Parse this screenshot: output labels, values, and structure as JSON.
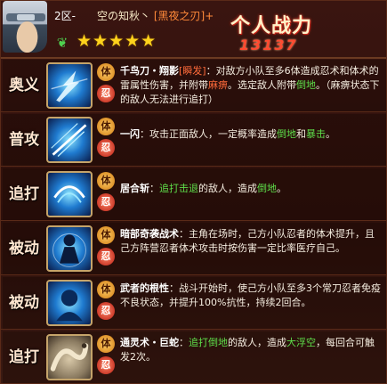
{
  "header": {
    "server": "2区-",
    "player_name": "空の知秋丶",
    "title": "[黑夜之刃]+",
    "stars": "★★★★★",
    "clan_icon": "leaf-clan-icon",
    "power_label": "个人战力",
    "power_value": "13137"
  },
  "skills": [
    {
      "category": "奥义",
      "icon": "chidori-lightning-icon",
      "name": "千鸟刀・翔影",
      "tag": "[瞬发]",
      "text_1": "：对敌方小队至多6体造成忍术和体术的雷属性伤害，并附带",
      "hl_1": "麻痹",
      "text_2": "。选定敌人附带",
      "hl_2": "倒地",
      "text_3": "。（麻痹状态下的敌人无法进行追打）"
    },
    {
      "category": "普攻",
      "icon": "slash-icon",
      "name": "一闪",
      "text_1": "：攻击正面敌人，一定概率造成",
      "hl_1": "倒地",
      "text_2": "和",
      "hl_2": "暴击",
      "text_3": "。"
    },
    {
      "category": "追打",
      "icon": "iai-slash-icon",
      "name": "居合斩",
      "text_1": "：",
      "hl_1": "追打击退",
      "text_2": "的敌人，造成",
      "hl_2": "倒地",
      "text_3": "。"
    },
    {
      "category": "被动",
      "icon": "shadow-figure-icon",
      "name": "暗部奇袭战术",
      "text_1": "：主角在场时，己方小队忍者的体术提升，且己方阵营忍者体术攻击时按伤害一定比率医疗自己。"
    },
    {
      "category": "被动",
      "icon": "blue-head-icon",
      "name": "武者的根性",
      "text_1": "：战斗开始时，使己方小队至多3个常刀忍者免疫不良状态，并提升100%抗性，持续2回合。"
    },
    {
      "category": "追打",
      "icon": "giant-snake-icon",
      "name": "通灵术・巨蛇",
      "text_1": "：",
      "hl_1": "追打倒地",
      "text_2": "的敌人，造成",
      "hl_2": "大浮空",
      "text_3": "，每回合可触发2次。"
    }
  ],
  "tags": {
    "body": "体",
    "ninja": "忍"
  },
  "colors": {
    "accent_red": "#ff4a30",
    "highlight_green": "#5ede4a",
    "star_gold": "#ffd21c",
    "tag_orange": "#ff6a3a"
  }
}
